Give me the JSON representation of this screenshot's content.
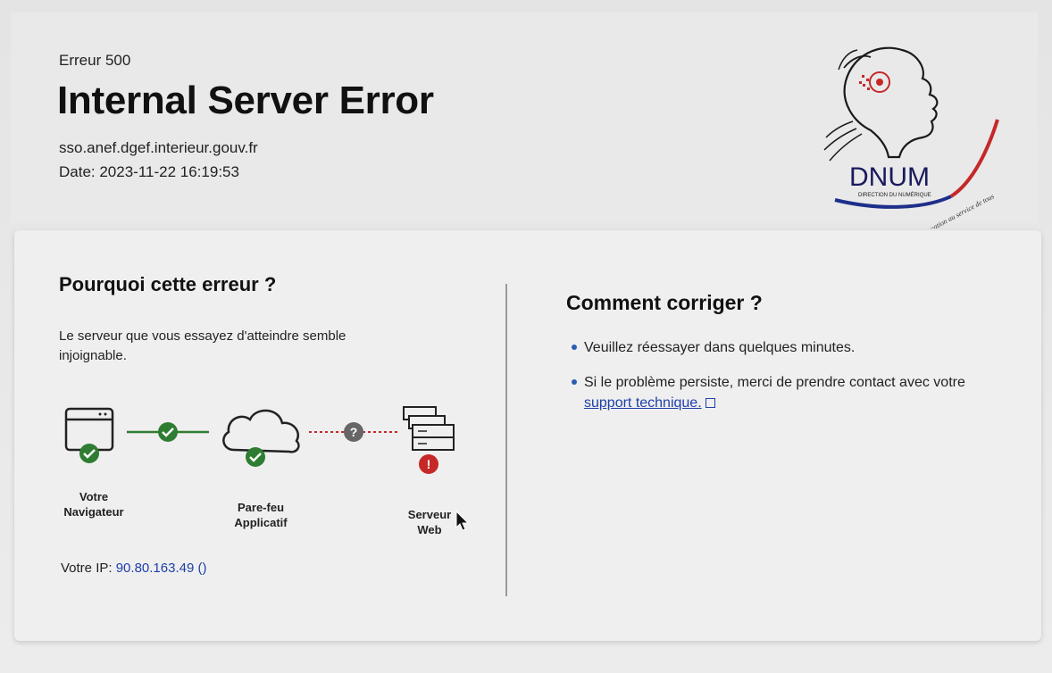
{
  "header": {
    "error_code": "Erreur 500",
    "title": "Internal Server Error",
    "host": "sso.anef.dgef.interieur.gouv.fr",
    "date": "Date: 2023-11-22 16:19:53"
  },
  "logo": {
    "name": "DNUM",
    "subtitle": "DIRECTION DU NUMÉRIQUE",
    "tagline": "L'innovation au service de tous"
  },
  "why": {
    "title": "Pourquoi cette erreur ?",
    "description": "Le serveur que vous essayez d'atteindre semble injoignable.",
    "nodes": [
      {
        "label_line1": "Votre",
        "label_line2": "Navigateur",
        "status": "ok",
        "icon": "browser-icon"
      },
      {
        "label_line1": "Pare-feu",
        "label_line2": "Applicatif",
        "status": "ok",
        "icon": "cloud-icon"
      },
      {
        "label_line1": "Serveur",
        "label_line2": "Web",
        "status": "error",
        "icon": "server-icon"
      }
    ],
    "ip_label": "Votre IP:",
    "ip_value": "90.80.163.49 ()"
  },
  "fix": {
    "title": "Comment corriger ?",
    "items": [
      {
        "text": "Veuillez réessayer dans quelques minutes."
      },
      {
        "text": "Si le problème persiste, merci de prendre contact avec votre",
        "link": "support technique."
      }
    ]
  },
  "colors": {
    "ok_green": "#2e7d32",
    "error_red": "#c62828",
    "unknown_gray": "#666666",
    "link_blue": "#1d3fa8",
    "connector_red": "#c62828"
  }
}
